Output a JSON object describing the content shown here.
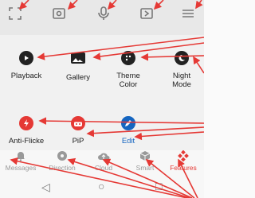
{
  "top_toolbar": {
    "icons": [
      "expand-corners-icon",
      "screenshot-icon",
      "microphone-icon",
      "video-call-icon",
      "menu-lines-icon"
    ]
  },
  "tiles_row1": [
    {
      "label": "Playback",
      "icon": "play-circle-icon"
    },
    {
      "label": "Gallery",
      "icon": "image-icon"
    },
    {
      "label": "Theme\nColor",
      "icon": "palette-icon"
    },
    {
      "label": "Night\nMode",
      "icon": "moon-icon"
    }
  ],
  "tiles_row2": [
    {
      "label": "Anti-Flicke",
      "icon": "lightning-icon"
    },
    {
      "label": "PiP",
      "icon": "pip-robot-icon"
    },
    {
      "label": "Edit",
      "icon": "pencil-icon"
    }
  ],
  "bottom_nav": [
    {
      "label": "Messages",
      "icon": "bell-icon"
    },
    {
      "label": "Direction",
      "icon": "joystick-icon"
    },
    {
      "label": "Cloud",
      "icon": "cloud-upload-icon"
    },
    {
      "label": "Smart",
      "icon": "cube-icon"
    },
    {
      "label": "Features",
      "icon": "diamond-dots-icon",
      "active": true
    }
  ],
  "system_nav": {
    "back": "◁",
    "home": "○",
    "recent": "□"
  },
  "colors": {
    "accent": "#e53935",
    "panel": "#f1f1f1",
    "topbar": "#e8e8e8"
  }
}
